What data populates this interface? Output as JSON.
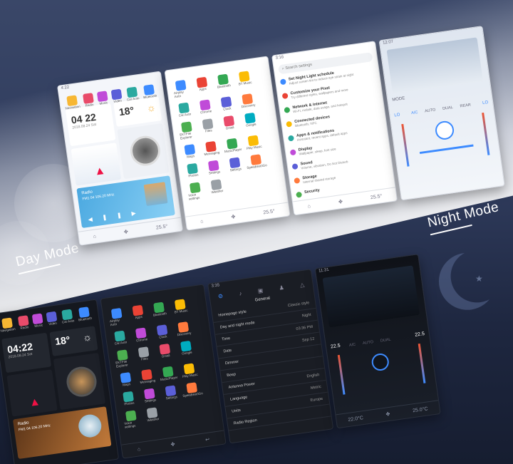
{
  "labels": {
    "day": "Day Mode",
    "night": "Night Mode"
  },
  "day": {
    "home": {
      "status": "4:22",
      "apps": [
        "Navigation",
        "Radio",
        "Music",
        "Video",
        "Car Auto",
        "Bluetooth"
      ],
      "time": "04 22",
      "date": "2018.08.24 Sat",
      "temp": "18°",
      "radio_title": "Radio",
      "radio_freq": "FM1 04   106.20 MHz",
      "nav": [
        "⌂",
        "✤",
        "25.5°"
      ]
    },
    "apps": {
      "names": [
        "Airplay Auto",
        "Apps",
        "Bluetooth",
        "BT Music",
        "Car Auto",
        "Chrome",
        "Clock",
        "Discovery",
        "EKTFile Explorer",
        "Files",
        "Gmail",
        "Google",
        "Maps",
        "Messaging",
        "MusicPlayer",
        "Play Music",
        "Photos",
        "Settings",
        "Settings",
        "Speedtest/iGo",
        "Voice settings",
        "Weather"
      ],
      "nav": [
        "⌂",
        "✤",
        "25.5°"
      ]
    },
    "settings": {
      "status": "3:16",
      "search": "Search settings",
      "items": [
        {
          "t": "Set Night Light schedule",
          "d": "Adjust screen tint to reduce eye strain at night"
        },
        {
          "t": "Customize your Pixel",
          "d": "Try different styles, wallpapers and more"
        },
        {
          "t": "Network & internet",
          "d": "Wi-Fi, mobile, data usage, and hotspot"
        },
        {
          "t": "Connected devices",
          "d": "Bluetooth, NFC"
        },
        {
          "t": "Apps & notifications",
          "d": "Assistant, recent apps, default apps"
        },
        {
          "t": "Display",
          "d": "Wallpaper, sleep, font size"
        },
        {
          "t": "Sound",
          "d": "Volume, vibration, Do Not Disturb"
        },
        {
          "t": "Storage",
          "d": "Internal shared storage"
        },
        {
          "t": "Security",
          "d": ""
        }
      ],
      "nav": [
        "⌂",
        "✤",
        "25.5°"
      ]
    },
    "climate": {
      "status": "12:07",
      "lo": "LO",
      "ac": "A/C",
      "auto": "AUTO",
      "dual": "DUAL",
      "rear": "REAR",
      "mode": "MODE"
    }
  },
  "night": {
    "home": {
      "apps": [
        "Navigation",
        "Radio",
        "Music",
        "Video",
        "Car Auto",
        "Bluetooth"
      ],
      "time": "04:22",
      "date": "2018.08.24 Sat",
      "temp": "18°",
      "radio_title": "Radio",
      "radio_freq": "FM1 04   106.20 MHz"
    },
    "apps": {
      "names": [
        "Airplay Auto",
        "Apps",
        "Bluetooth",
        "BT Music",
        "Car Auto",
        "Chrome",
        "Clock",
        "Discovery",
        "EKTFile Explorer",
        "Files",
        "Gmail",
        "Google",
        "Maps",
        "Messaging",
        "MusicPlayer",
        "Play Music",
        "Photos",
        "Settings",
        "Settings",
        "Speedtest/iGo",
        "Voice settings",
        "Weather"
      ]
    },
    "settings": {
      "status": "3:35",
      "title": "General",
      "rows": [
        {
          "k": "Homepage style",
          "v": "Classic style"
        },
        {
          "k": "Day and night mode",
          "v": "Night"
        },
        {
          "k": "Time",
          "v": "03:36 PM"
        },
        {
          "k": "Date",
          "v": "Sep 12"
        },
        {
          "k": "Dimmer",
          "v": ""
        },
        {
          "k": "Beep",
          "v": ""
        },
        {
          "k": "Antenna Power",
          "v": "English"
        },
        {
          "k": "Language",
          "v": "Metric"
        },
        {
          "k": "Units",
          "v": "Europe"
        },
        {
          "k": "Radio Region",
          "v": ""
        }
      ]
    },
    "climate": {
      "status": "11:31",
      "t1": "22.5",
      "t2": "22.5",
      "ac": "A/C",
      "auto": "AUTO",
      "dual": "DUAL",
      "nav": [
        "22.0°C",
        "25.0°C"
      ]
    }
  },
  "colors": {
    "accent": "#3d8bff",
    "day_bg": "#f4f6fa",
    "night_bg": "#15181f"
  }
}
